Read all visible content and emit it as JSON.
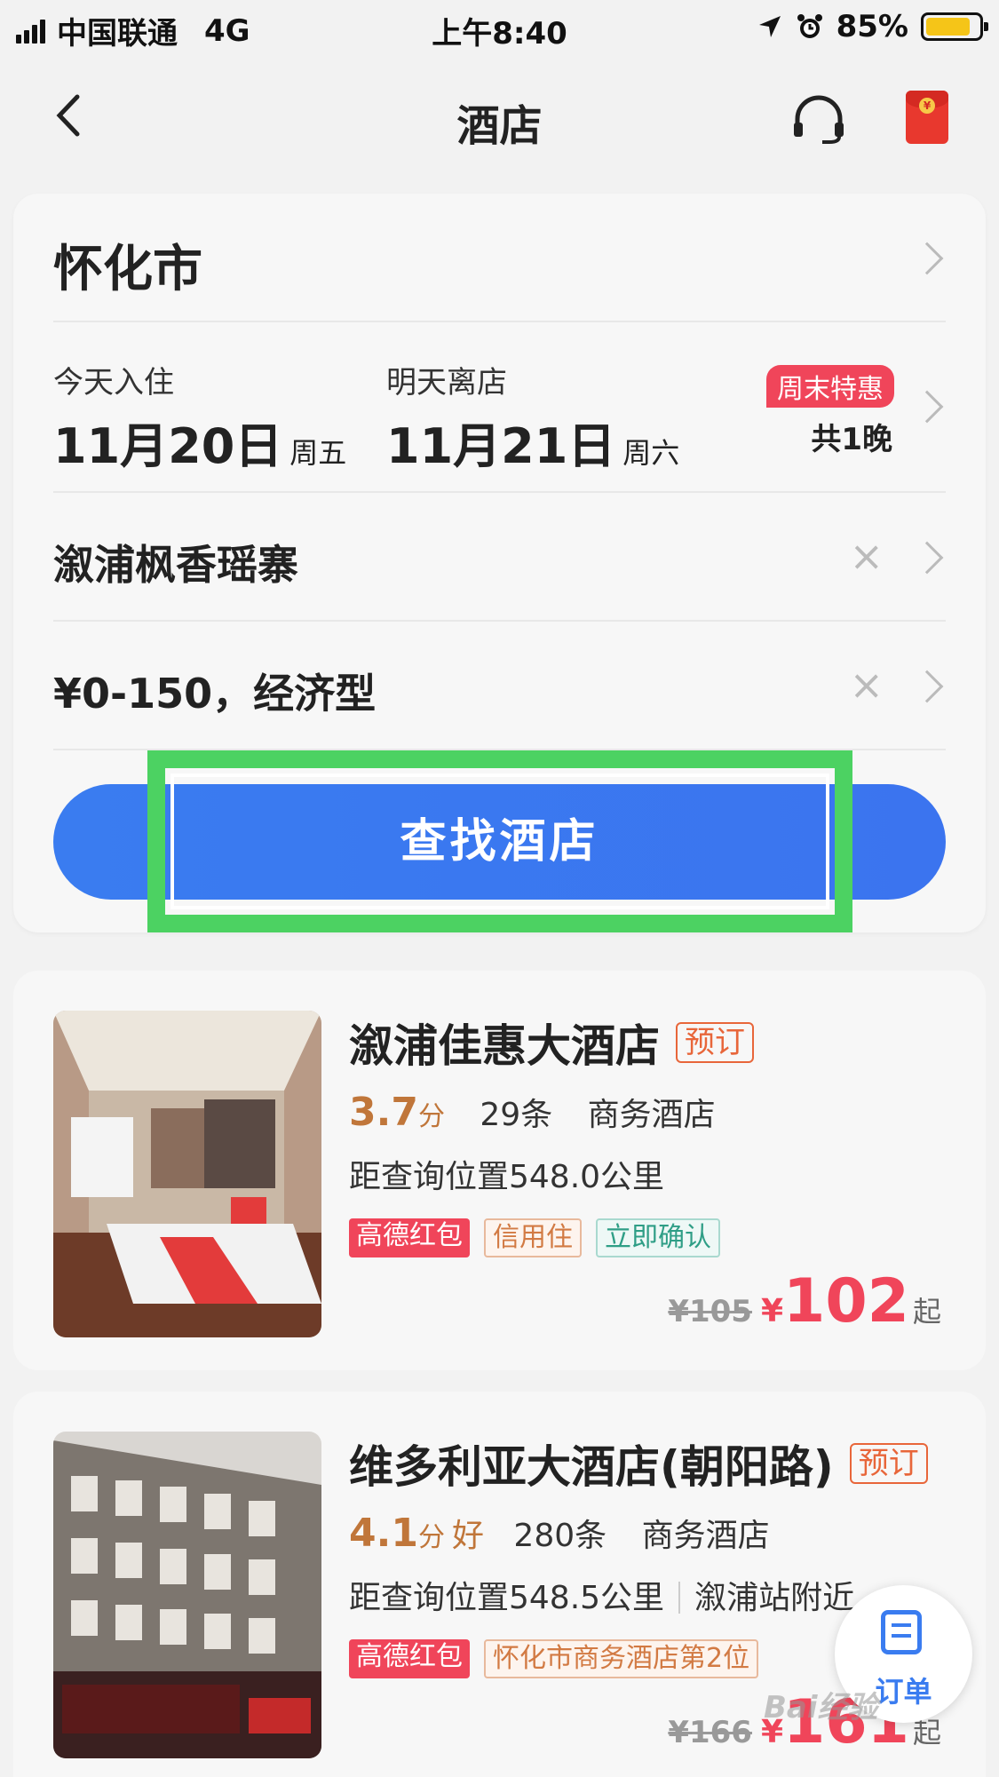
{
  "status_bar": {
    "carrier": "中国联通",
    "network": "4G",
    "time": "上午8:40",
    "battery": "85%",
    "battery_level": 0.85,
    "icons": [
      "signal-icon",
      "location-icon",
      "alarm-icon",
      "battery-icon"
    ]
  },
  "navbar": {
    "title": "酒店",
    "icons": [
      "back-icon",
      "headset-icon",
      "red-packet-icon"
    ]
  },
  "search": {
    "city": "怀化市",
    "checkin_label": "今天入住",
    "checkin_date": "11月20日",
    "checkin_weekday": "周五",
    "checkout_label": "明天离店",
    "checkout_date": "11月21日",
    "checkout_weekday": "周六",
    "weekend_badge": "周末特惠",
    "nights": "共1晚",
    "keyword": "溆浦枫香瑶寨",
    "price_filter": "¥0-150，经济型",
    "clear_symbol": "×",
    "search_button": "查找酒店"
  },
  "hotels": [
    {
      "name": "溆浦佳惠大酒店",
      "book_tag": "预订",
      "score": "3.7",
      "score_unit": "分",
      "reviews": "29条",
      "type": "商务酒店",
      "distance": "距查询位置548.0公里",
      "tags": [
        "高德红包",
        "信用住",
        "立即确认"
      ],
      "original_price": "¥105",
      "currency": "¥",
      "price": "102",
      "price_suffix": "起"
    },
    {
      "name": "维多利亚大酒店(朝阳路)",
      "book_tag": "预订",
      "score": "4.1",
      "score_unit": "分",
      "score_word": "好",
      "reviews": "280条",
      "type": "商务酒店",
      "distance": "距查询位置548.5公里",
      "area": "溆浦站附近",
      "tags": [
        "高德红包",
        "怀化市商务酒店第2位"
      ],
      "original_price": "¥166",
      "currency": "¥",
      "price": "161",
      "price_suffix": "起"
    }
  ],
  "fab": {
    "label": "订单",
    "icon": "order-list-icon"
  },
  "watermark": "Bai经验",
  "colors": {
    "accent_blue": "#3a7cf0",
    "price_red": "#f0455a",
    "score_brown": "#c0763a",
    "highlight_green": "#4cd262"
  }
}
